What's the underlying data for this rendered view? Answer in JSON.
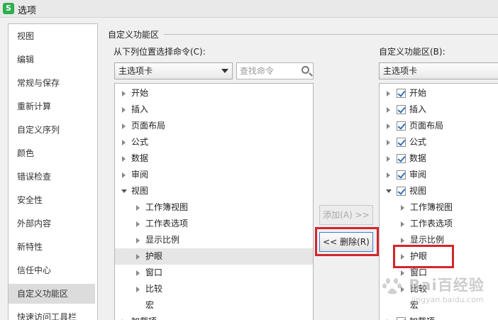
{
  "window": {
    "app_icon_letter": "S",
    "title": "选项"
  },
  "sidebar": {
    "items": [
      {
        "label": "视图",
        "selected": false
      },
      {
        "label": "编辑",
        "selected": false
      },
      {
        "label": "常规与保存",
        "selected": false
      },
      {
        "label": "重新计算",
        "selected": false
      },
      {
        "label": "自定义序列",
        "selected": false
      },
      {
        "label": "颜色",
        "selected": false
      },
      {
        "label": "错误检查",
        "selected": false
      },
      {
        "label": "安全性",
        "selected": false
      },
      {
        "label": "外部内容",
        "selected": false
      },
      {
        "label": "新特性",
        "selected": false
      },
      {
        "label": "信任中心",
        "selected": false
      },
      {
        "label": "自定义功能区",
        "selected": true
      },
      {
        "label": "快速访问工具栏",
        "selected": false
      }
    ]
  },
  "group": {
    "title": "自定义功能区"
  },
  "left": {
    "label": "从下列位置选择命令(C):",
    "combo_value": "主选项卡",
    "search_placeholder": "查找命令",
    "tree": [
      {
        "label": "开始",
        "level": 0,
        "expander": "collapsed",
        "selected": false
      },
      {
        "label": "插入",
        "level": 0,
        "expander": "collapsed",
        "selected": false
      },
      {
        "label": "页面布局",
        "level": 0,
        "expander": "collapsed",
        "selected": false
      },
      {
        "label": "公式",
        "level": 0,
        "expander": "collapsed",
        "selected": false
      },
      {
        "label": "数据",
        "level": 0,
        "expander": "collapsed",
        "selected": false
      },
      {
        "label": "审阅",
        "level": 0,
        "expander": "collapsed",
        "selected": false
      },
      {
        "label": "视图",
        "level": 0,
        "expander": "expanded",
        "selected": false
      },
      {
        "label": "工作簿视图",
        "level": 1,
        "expander": "collapsed",
        "selected": false
      },
      {
        "label": "工作表选项",
        "level": 1,
        "expander": "collapsed",
        "selected": false
      },
      {
        "label": "显示比例",
        "level": 1,
        "expander": "collapsed",
        "selected": false
      },
      {
        "label": "护眼",
        "level": 1,
        "expander": "collapsed",
        "selected": true
      },
      {
        "label": "窗口",
        "level": 1,
        "expander": "collapsed",
        "selected": false
      },
      {
        "label": "比较",
        "level": 1,
        "expander": "collapsed",
        "selected": false
      },
      {
        "label": "宏",
        "level": 1,
        "expander": "none",
        "selected": false
      },
      {
        "label": "加载项",
        "level": 0,
        "expander": "collapsed",
        "selected": false
      }
    ]
  },
  "buttons": {
    "add": "添加(A) >>",
    "remove": "<< 删除(R)"
  },
  "right": {
    "label": "自定义功能区(B):",
    "combo_value": "主选项卡",
    "tree": [
      {
        "label": "开始",
        "level": 0,
        "expander": "collapsed",
        "checked": true
      },
      {
        "label": "插入",
        "level": 0,
        "expander": "collapsed",
        "checked": true
      },
      {
        "label": "页面布局",
        "level": 0,
        "expander": "collapsed",
        "checked": true
      },
      {
        "label": "公式",
        "level": 0,
        "expander": "collapsed",
        "checked": true
      },
      {
        "label": "数据",
        "level": 0,
        "expander": "collapsed",
        "checked": true
      },
      {
        "label": "审阅",
        "level": 0,
        "expander": "collapsed",
        "checked": true
      },
      {
        "label": "视图",
        "level": 0,
        "expander": "expanded",
        "checked": true
      },
      {
        "label": "工作簿视图",
        "level": 1,
        "expander": "collapsed",
        "checked": false
      },
      {
        "label": "工作表选项",
        "level": 1,
        "expander": "collapsed",
        "checked": false
      },
      {
        "label": "显示比例",
        "level": 1,
        "expander": "collapsed",
        "checked": false
      },
      {
        "label": "护眼",
        "level": 1,
        "expander": "collapsed",
        "checked": false
      },
      {
        "label": "窗口",
        "level": 1,
        "expander": "collapsed",
        "checked": false
      },
      {
        "label": "比较",
        "level": 1,
        "expander": "collapsed",
        "checked": false
      },
      {
        "label": "宏",
        "level": 1,
        "expander": "none",
        "checked": false
      },
      {
        "label": "加载项",
        "level": 0,
        "expander": "collapsed",
        "checked": true
      }
    ]
  },
  "watermark": {
    "text": "Bai百经验",
    "sub": "jingyan.baidu.com"
  },
  "colors": {
    "highlight_red": "#d3252b",
    "app_green": "#2eae4e",
    "check_blue": "#3470b8"
  }
}
